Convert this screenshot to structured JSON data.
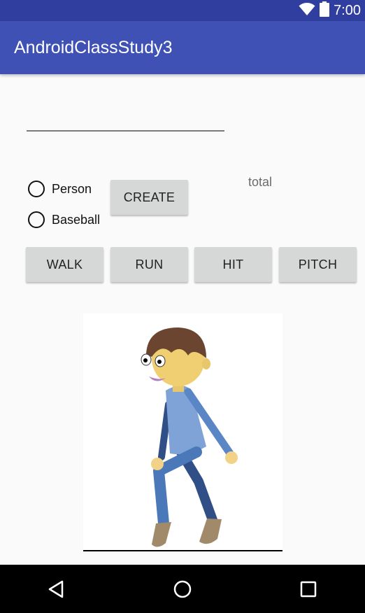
{
  "status_bar": {
    "time": "7:00",
    "icons": [
      "wifi-icon",
      "battery-icon"
    ]
  },
  "app_bar": {
    "title": "AndroidClassStudy3"
  },
  "input": {
    "value": "",
    "placeholder": ""
  },
  "radio_options": [
    {
      "label": "Person",
      "checked": false
    },
    {
      "label": "Baseball",
      "checked": false
    }
  ],
  "buttons": {
    "create": "CREATE",
    "walk": "WALK",
    "run": "RUN",
    "hit": "HIT",
    "pitch": "PITCH"
  },
  "total_label": "total",
  "nav_bar": {
    "icons": [
      "back-icon",
      "home-icon",
      "recents-icon"
    ]
  },
  "colors": {
    "status_bar": "#303f9f",
    "app_bar": "#3f51b5",
    "button": "#d6d7d7",
    "nav_bar": "#000000"
  }
}
